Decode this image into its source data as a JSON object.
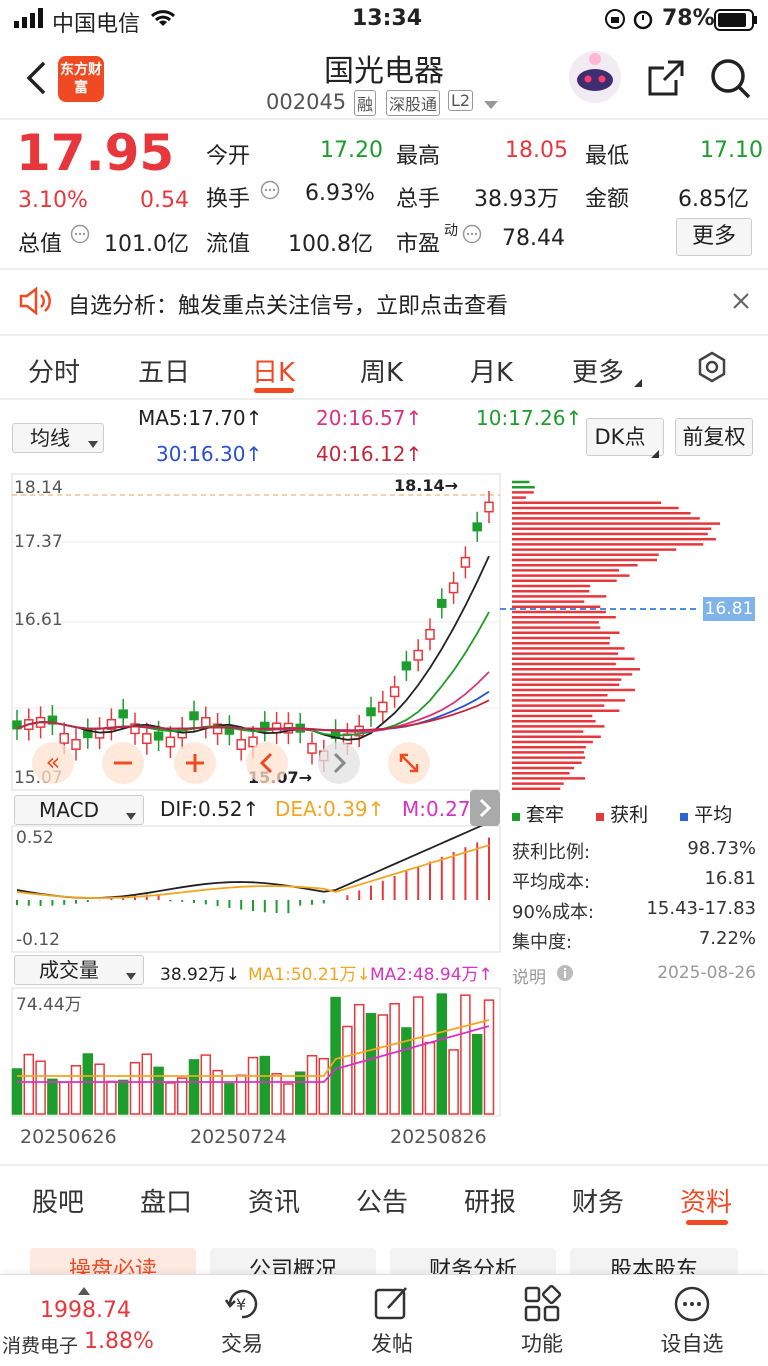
{
  "status_bar": {
    "carrier": "中国电信",
    "time": "13:34",
    "battery": "78%"
  },
  "header": {
    "logo": "东方财富",
    "title": "国光电器",
    "code": "002045",
    "tags": [
      "融",
      "深股通",
      "L2"
    ]
  },
  "quote": {
    "price": "17.95",
    "change_pct": "3.10%",
    "change": "0.54",
    "open_label": "今开",
    "open": "17.20",
    "high_label": "最高",
    "high": "18.05",
    "low_label": "最低",
    "low": "17.10",
    "turnover_label": "换手",
    "turnover": "6.93%",
    "volume_label": "总手",
    "volume": "38.93万",
    "amount_label": "金额",
    "amount": "6.85亿",
    "mktcap_label": "总值",
    "mktcap": "101.0亿",
    "float_label": "流值",
    "float": "100.8亿",
    "pe_label": "市盈",
    "pe_sup": "动",
    "pe": "78.44",
    "more_btn": "更多"
  },
  "notice": {
    "text": "自选分析：触发重点关注信号，立即点击查看"
  },
  "period_tabs": [
    "分时",
    "五日",
    "日K",
    "周K",
    "月K",
    "更多"
  ],
  "period_active": 2,
  "ma": {
    "selector": "均线",
    "ma5": "MA5:17.70↑",
    "ma20": "20:16.57↑",
    "ma10": "10:17.26↑",
    "ma30": "30:16.30↑",
    "ma40": "40:16.12↑",
    "dk_btn": "DK点",
    "fq_btn": "前复权"
  },
  "kline": {
    "y_labels": [
      "18.14",
      "17.37",
      "16.61",
      "15.07"
    ],
    "high_mark": "18.14→",
    "low_mark": "15.07→",
    "cost_line": "16.81"
  },
  "macd": {
    "selector": "MACD",
    "dif": "DIF:0.52↑",
    "dea": "DEA:0.39↑",
    "m": "M:0.27↑",
    "y_top": "0.52",
    "y_bottom": "-0.12"
  },
  "volume": {
    "selector": "成交量",
    "vol": "38.92万↓",
    "ma1": "MA1:50.21万↓",
    "ma2": "MA2:48.94万↑",
    "y_top": "74.44万",
    "dates": [
      "20250626",
      "20250724",
      "20250826"
    ]
  },
  "chip": {
    "legend": [
      "套牢",
      "获利",
      "平均"
    ],
    "rows": [
      {
        "k": "获利比例:",
        "v": "98.73%"
      },
      {
        "k": "平均成本:",
        "v": "16.81"
      },
      {
        "k": "90%成本:",
        "v": "15.43-17.83"
      },
      {
        "k": "集中度:",
        "v": "7.22%"
      }
    ],
    "note": "说明",
    "date": "2025-08-26"
  },
  "bottom_tabs": [
    "股吧",
    "盘口",
    "资讯",
    "公告",
    "研报",
    "财务",
    "资料"
  ],
  "bottom_active": 6,
  "sub_tabs": [
    "操盘必读",
    "公司概况",
    "财务分析",
    "股本股东"
  ],
  "nav": {
    "index_value": "1998.74",
    "index_name": "消费电子",
    "index_pct": "1.88%",
    "items": [
      "交易",
      "发帖",
      "功能",
      "设自选"
    ]
  },
  "colors": {
    "up": "#e8373c",
    "down": "#1d9d2c",
    "accent": "#f04a23"
  }
}
